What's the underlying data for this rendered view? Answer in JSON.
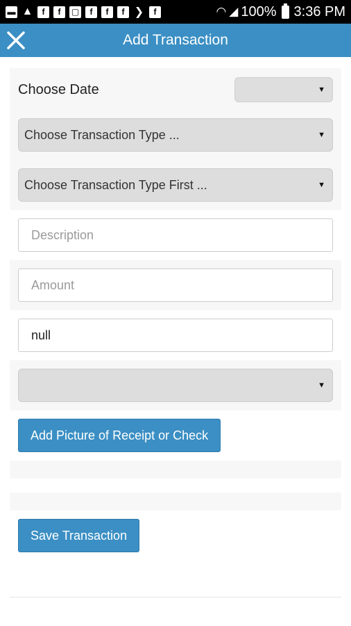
{
  "status_bar": {
    "battery": "100%",
    "time": "3:36 PM",
    "icons": [
      "message-icon",
      "warning-icon",
      "facebook-icon",
      "facebook-icon",
      "clipboard-icon",
      "facebook-icon",
      "facebook-icon",
      "facebook-icon",
      "chevron-right-icon",
      "facebook-icon",
      "wifi-icon",
      "signal-icon",
      "battery-icon"
    ]
  },
  "header": {
    "title": "Add Transaction",
    "close_icon": "close-icon",
    "color": "#3b8fc4"
  },
  "form": {
    "date_label": "Choose Date",
    "date_value": "",
    "transaction_type_select": "Choose Transaction Type ...",
    "category_select": "Choose Transaction Type First ...",
    "description_placeholder": "Description",
    "amount_placeholder": "Amount",
    "notes_value": "null",
    "extra_select_value": "",
    "caret_glyph": "▼"
  },
  "buttons": {
    "add_picture": "Add Picture of Receipt or Check",
    "save": "Save Transaction"
  }
}
